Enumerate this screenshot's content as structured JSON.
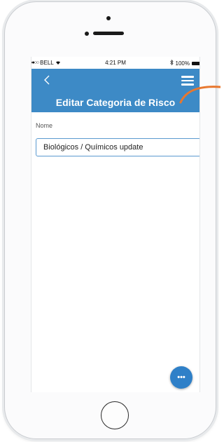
{
  "status_bar": {
    "signal_dots": "●●●○○",
    "carrier": "BELL",
    "wifi_icon": "wifi-icon",
    "time": "4:21 PM",
    "bluetooth_icon": "bluetooth-icon",
    "battery": "100%"
  },
  "app_bar": {
    "title": "Editar Categoria de Risco",
    "back_icon": "chevron-left-icon",
    "menu_icon": "hamburger-menu-icon",
    "background_color": "#3d8ac6"
  },
  "form": {
    "name_label": "Nome",
    "name_value": "Biológicos / Químicos update"
  },
  "fab": {
    "label": "•••",
    "color": "#2f80c8"
  },
  "annotation": {
    "color": "#e8772e"
  }
}
